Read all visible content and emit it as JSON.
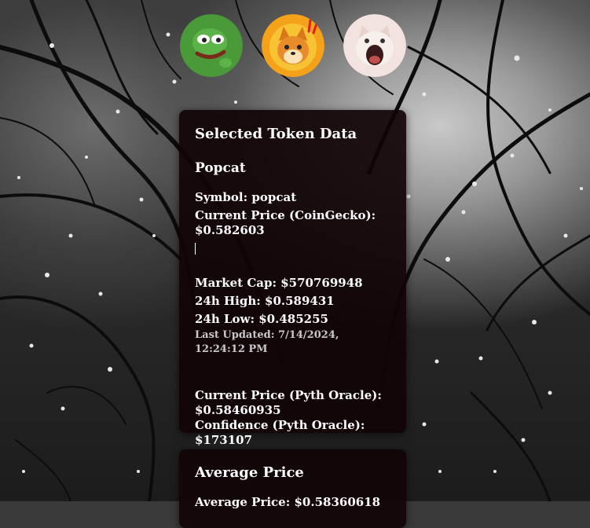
{
  "tokens": [
    {
      "name": "Pepe",
      "icon": "pepe-icon"
    },
    {
      "name": "Bonk",
      "icon": "bonk-dog-icon"
    },
    {
      "name": "Popcat",
      "icon": "popcat-icon"
    }
  ],
  "selected": {
    "heading": "Selected Token Data",
    "token_name": "Popcat",
    "symbol_line": "Symbol: popcat",
    "cg_price_label": "Current Price (CoinGecko):",
    "cg_price_value": "$0.582603",
    "market_cap": "Market Cap: $570769948",
    "high_24h": "24h High: $0.589431",
    "low_24h": "24h Low: $0.485255",
    "last_updated": "Last Updated: 7/14/2024, 12:24:12 PM",
    "pyth_price_label": "Current Price (Pyth Oracle):",
    "pyth_price_value": "$0.58460935",
    "pyth_confidence": "Confidence (Pyth Oracle): $173107"
  },
  "average": {
    "heading": "Average Price",
    "value_line": "Average Price: $0.58360618"
  },
  "colors": {
    "card_bg": "#120408",
    "pepe_green": "#4a9a3a",
    "bonk_orange": "#f4a21a",
    "popcat_bg": "#f2e2e0"
  }
}
